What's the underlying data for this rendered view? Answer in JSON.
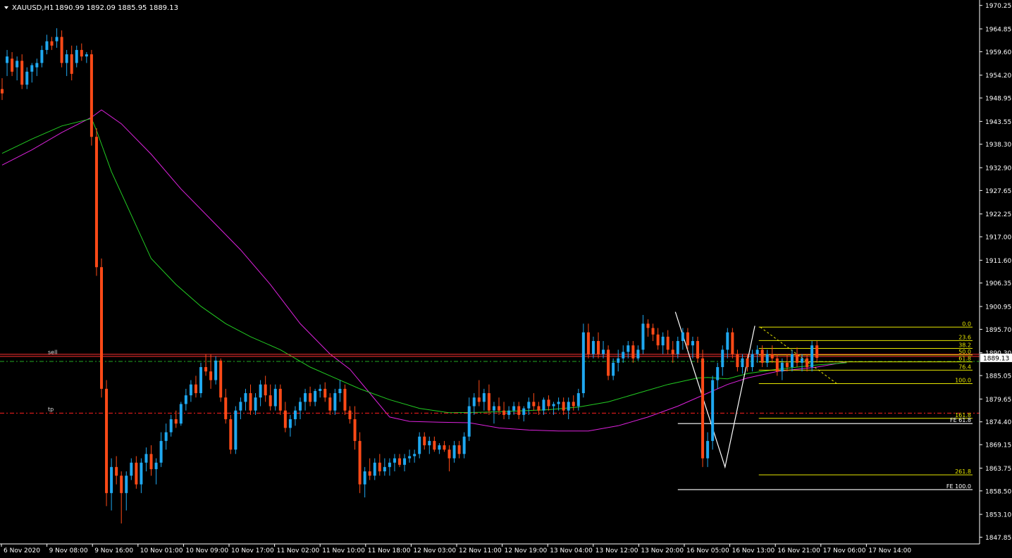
{
  "header": {
    "symbol": "XAUUSD,H1",
    "ohlc": "1890.99 1892.09 1885.95 1889.13"
  },
  "chart_data": {
    "type": "candlestick",
    "symbol": "XAUUSD",
    "timeframe": "H1",
    "ylim": [
      1846.3,
      1971.5
    ],
    "y_ticks": [
      "1970.25",
      "1964.85",
      "1959.60",
      "1954.20",
      "1948.95",
      "1943.55",
      "1938.30",
      "1932.90",
      "1927.65",
      "1922.25",
      "1917.00",
      "1911.60",
      "1906.35",
      "1900.95",
      "1895.70",
      "1890.30",
      "1885.05",
      "1879.65",
      "1874.40",
      "1869.15",
      "1863.75",
      "1858.50",
      "1853.10",
      "1847.85"
    ],
    "x_ticks": [
      "6 Nov 2020",
      "9 Nov 08:00",
      "9 Nov 16:00",
      "10 Nov 01:00",
      "10 Nov 09:00",
      "10 Nov 17:00",
      "11 Nov 02:00",
      "11 Nov 10:00",
      "11 Nov 18:00",
      "12 Nov 03:00",
      "12 Nov 11:00",
      "12 Nov 19:00",
      "13 Nov 04:00",
      "13 Nov 12:00",
      "13 Nov 20:00",
      "16 Nov 05:00",
      "16 Nov 13:00",
      "16 Nov 21:00",
      "17 Nov 06:00",
      "17 Nov 14:00"
    ],
    "colors": {
      "bull": "#1fa8f0",
      "bear": "#ff4a17",
      "ma_fast": "#22cc22",
      "ma_slow": "#dd22dd",
      "fib": "#e6e600",
      "fe": "#ffffff",
      "sell": "#ff3030",
      "tp": "#ff2020",
      "bid": "#22aa22"
    },
    "levels": {
      "sell": {
        "label": "sell",
        "price": 1889.7
      },
      "tp": {
        "label": "tp",
        "price": 1876.4
      },
      "bid": 1888.3,
      "current": {
        "label": "1889.13",
        "price": 1889.13
      }
    },
    "fib_retracement": [
      {
        "label": "0.0",
        "price": 1896.2
      },
      {
        "label": "23.6",
        "price": 1893.1
      },
      {
        "label": "38.2",
        "price": 1891.3
      },
      {
        "label": "50.0",
        "price": 1889.8
      },
      {
        "label": "61.8",
        "price": 1888.2
      },
      {
        "label": "76.4",
        "price": 1886.3
      },
      {
        "label": "100.0",
        "price": 1883.2
      },
      {
        "label": "161.8",
        "price": 1875.2
      },
      {
        "label": "261.8",
        "price": 1862.2
      }
    ],
    "fib_expansion": [
      {
        "label": "FE 61.8",
        "price": 1874.0
      },
      {
        "label": "FE 100.0",
        "price": 1858.8
      }
    ],
    "candles": [
      [
        1951.0,
        1953.5,
        1948.5,
        1950.0
      ],
      [
        1957.0,
        1960.0,
        1954.0,
        1958.5
      ],
      [
        1958.0,
        1959.5,
        1954.0,
        1955.0
      ],
      [
        1956.0,
        1958.5,
        1953.0,
        1957.5
      ],
      [
        1957.5,
        1959.0,
        1951.0,
        1952.0
      ],
      [
        1952.0,
        1956.0,
        1951.0,
        1955.0
      ],
      [
        1955.0,
        1957.0,
        1952.5,
        1956.5
      ],
      [
        1956.0,
        1958.0,
        1954.0,
        1957.0
      ],
      [
        1957.0,
        1961.0,
        1956.0,
        1960.0
      ],
      [
        1960.0,
        1963.5,
        1959.0,
        1962.0
      ],
      [
        1962.0,
        1963.0,
        1960.0,
        1961.0
      ],
      [
        1962.0,
        1965.0,
        1960.5,
        1963.0
      ],
      [
        1963.0,
        1964.5,
        1956.0,
        1957.0
      ],
      [
        1957.0,
        1960.0,
        1954.0,
        1959.0
      ],
      [
        1959.0,
        1961.0,
        1953.0,
        1954.5
      ],
      [
        1957.0,
        1961.0,
        1956.0,
        1960.0
      ],
      [
        1960.0,
        1961.5,
        1957.5,
        1958.5
      ],
      [
        1958.5,
        1959.5,
        1957.0,
        1959.0
      ],
      [
        1959.0,
        1960.0,
        1938.0,
        1940.0
      ],
      [
        1940.0,
        1942.0,
        1908.0,
        1910.0
      ],
      [
        1910.0,
        1912.0,
        1880.0,
        1882.0
      ],
      [
        1882.0,
        1884.0,
        1855.0,
        1858.0
      ],
      [
        1858.0,
        1866.0,
        1854.0,
        1864.0
      ],
      [
        1864.0,
        1866.5,
        1860.0,
        1862.0
      ],
      [
        1862.0,
        1863.0,
        1851.0,
        1858.0
      ],
      [
        1858.0,
        1863.0,
        1854.0,
        1862.0
      ],
      [
        1862.0,
        1866.0,
        1861.0,
        1865.0
      ],
      [
        1865.0,
        1866.5,
        1859.0,
        1860.0
      ],
      [
        1860.0,
        1866.0,
        1858.0,
        1865.0
      ],
      [
        1865.0,
        1868.5,
        1863.0,
        1867.0
      ],
      [
        1867.0,
        1869.0,
        1862.0,
        1863.5
      ],
      [
        1863.5,
        1866.0,
        1860.0,
        1865.0
      ],
      [
        1865.0,
        1872.0,
        1864.0,
        1870.0
      ],
      [
        1870.0,
        1874.0,
        1868.0,
        1872.0
      ],
      [
        1872.0,
        1876.0,
        1871.0,
        1875.0
      ],
      [
        1875.0,
        1877.0,
        1873.0,
        1874.0
      ],
      [
        1874.0,
        1879.0,
        1873.5,
        1878.5
      ],
      [
        1878.5,
        1882.0,
        1877.0,
        1880.5
      ],
      [
        1880.5,
        1884.0,
        1879.0,
        1883.0
      ],
      [
        1883.0,
        1885.0,
        1880.0,
        1881.0
      ],
      [
        1881.0,
        1888.0,
        1880.0,
        1887.0
      ],
      [
        1887.0,
        1890.0,
        1885.0,
        1886.0
      ],
      [
        1886.0,
        1890.0,
        1882.0,
        1884.0
      ],
      [
        1884.0,
        1889.5,
        1883.0,
        1888.5
      ],
      [
        1888.5,
        1889.0,
        1879.0,
        1880.0
      ],
      [
        1880.0,
        1882.0,
        1874.0,
        1875.0
      ],
      [
        1875.0,
        1876.0,
        1867.0,
        1868.0
      ],
      [
        1868.0,
        1878.0,
        1867.0,
        1877.0
      ],
      [
        1877.0,
        1880.0,
        1875.0,
        1879.0
      ],
      [
        1879.0,
        1882.0,
        1877.0,
        1881.0
      ],
      [
        1881.0,
        1883.0,
        1876.0,
        1877.0
      ],
      [
        1877.0,
        1881.0,
        1876.0,
        1880.0
      ],
      [
        1880.0,
        1884.0,
        1878.0,
        1883.0
      ],
      [
        1883.0,
        1885.0,
        1879.0,
        1880.5
      ],
      [
        1880.5,
        1883.0,
        1877.0,
        1878.0
      ],
      [
        1878.0,
        1883.0,
        1877.0,
        1882.0
      ],
      [
        1882.0,
        1883.0,
        1876.0,
        1877.0
      ],
      [
        1877.0,
        1879.0,
        1872.0,
        1873.0
      ],
      [
        1873.0,
        1876.0,
        1871.0,
        1875.0
      ],
      [
        1875.0,
        1878.0,
        1873.5,
        1877.0
      ],
      [
        1877.0,
        1880.0,
        1875.0,
        1879.0
      ],
      [
        1879.0,
        1882.0,
        1877.0,
        1881.0
      ],
      [
        1881.0,
        1882.5,
        1878.0,
        1879.0
      ],
      [
        1879.0,
        1882.0,
        1878.0,
        1881.5
      ],
      [
        1881.5,
        1883.0,
        1880.0,
        1882.0
      ],
      [
        1882.0,
        1883.5,
        1879.0,
        1880.0
      ],
      [
        1880.0,
        1881.0,
        1876.0,
        1877.0
      ],
      [
        1877.0,
        1882.0,
        1876.0,
        1881.0
      ],
      [
        1881.0,
        1884.0,
        1879.0,
        1882.0
      ],
      [
        1882.0,
        1883.0,
        1876.0,
        1877.0
      ],
      [
        1877.0,
        1878.0,
        1874.0,
        1875.0
      ],
      [
        1875.0,
        1878.0,
        1868.0,
        1870.0
      ],
      [
        1870.0,
        1872.0,
        1858.0,
        1860.0
      ],
      [
        1860.0,
        1864.0,
        1857.0,
        1863.0
      ],
      [
        1863.0,
        1866.0,
        1861.0,
        1862.0
      ],
      [
        1862.0,
        1866.0,
        1861.0,
        1865.0
      ],
      [
        1865.0,
        1867.0,
        1862.0,
        1863.0
      ],
      [
        1863.0,
        1866.0,
        1862.0,
        1864.0
      ],
      [
        1864.0,
        1866.0,
        1862.0,
        1865.0
      ],
      [
        1865.0,
        1867.0,
        1863.0,
        1866.0
      ],
      [
        1866.0,
        1867.0,
        1864.0,
        1864.5
      ],
      [
        1864.5,
        1867.0,
        1863.0,
        1866.0
      ],
      [
        1866.0,
        1868.0,
        1865.0,
        1866.5
      ],
      [
        1866.5,
        1868.0,
        1865.0,
        1867.0
      ],
      [
        1867.0,
        1872.0,
        1866.0,
        1871.0
      ],
      [
        1871.0,
        1872.0,
        1868.0,
        1869.0
      ],
      [
        1869.0,
        1871.0,
        1867.0,
        1870.0
      ],
      [
        1870.0,
        1871.0,
        1867.5,
        1868.0
      ],
      [
        1868.0,
        1869.5,
        1867.0,
        1869.0
      ],
      [
        1869.0,
        1870.0,
        1867.5,
        1868.0
      ],
      [
        1868.0,
        1869.0,
        1863.0,
        1866.0
      ],
      [
        1866.0,
        1870.0,
        1865.0,
        1869.0
      ],
      [
        1869.0,
        1870.0,
        1866.0,
        1867.0
      ],
      [
        1867.0,
        1872.0,
        1866.0,
        1871.0
      ],
      [
        1871.0,
        1880.0,
        1870.0,
        1878.0
      ],
      [
        1878.0,
        1881.0,
        1876.0,
        1880.0
      ],
      [
        1880.0,
        1884.0,
        1878.0,
        1879.0
      ],
      [
        1879.0,
        1882.0,
        1877.0,
        1881.0
      ],
      [
        1881.0,
        1883.0,
        1876.0,
        1877.0
      ],
      [
        1877.0,
        1879.0,
        1874.0,
        1878.0
      ],
      [
        1878.0,
        1880.0,
        1876.0,
        1877.0
      ],
      [
        1877.0,
        1879.0,
        1875.0,
        1876.0
      ],
      [
        1876.0,
        1878.0,
        1875.0,
        1877.0
      ],
      [
        1877.0,
        1879.0,
        1876.0,
        1878.0
      ],
      [
        1878.0,
        1879.0,
        1875.0,
        1876.0
      ],
      [
        1876.0,
        1878.0,
        1874.5,
        1877.5
      ],
      [
        1877.5,
        1880.0,
        1876.0,
        1879.0
      ],
      [
        1879.0,
        1881.0,
        1877.0,
        1878.0
      ],
      [
        1878.0,
        1879.0,
        1876.0,
        1877.0
      ],
      [
        1877.0,
        1880.0,
        1876.0,
        1879.5
      ],
      [
        1879.5,
        1880.5,
        1877.0,
        1878.0
      ],
      [
        1878.0,
        1879.0,
        1876.0,
        1878.5
      ],
      [
        1878.5,
        1880.0,
        1877.0,
        1879.0
      ],
      [
        1879.0,
        1880.0,
        1876.0,
        1877.0
      ],
      [
        1877.0,
        1880.0,
        1875.0,
        1879.0
      ],
      [
        1879.0,
        1880.5,
        1877.0,
        1878.0
      ],
      [
        1878.0,
        1882.0,
        1877.0,
        1881.0
      ],
      [
        1881.0,
        1897.0,
        1880.0,
        1895.0
      ],
      [
        1895.0,
        1897.0,
        1889.0,
        1890.0
      ],
      [
        1890.0,
        1894.0,
        1889.0,
        1893.0
      ],
      [
        1893.0,
        1895.0,
        1889.0,
        1890.0
      ],
      [
        1890.0,
        1893.0,
        1889.0,
        1891.0
      ],
      [
        1891.0,
        1892.0,
        1884.0,
        1885.0
      ],
      [
        1885.0,
        1889.0,
        1884.0,
        1888.0
      ],
      [
        1888.0,
        1891.0,
        1886.0,
        1889.0
      ],
      [
        1889.0,
        1892.0,
        1888.0,
        1890.5
      ],
      [
        1890.5,
        1893.0,
        1889.0,
        1892.0
      ],
      [
        1892.0,
        1893.0,
        1888.0,
        1889.0
      ],
      [
        1889.0,
        1892.0,
        1888.5,
        1891.0
      ],
      [
        1891.0,
        1899.0,
        1890.0,
        1897.0
      ],
      [
        1897.0,
        1898.0,
        1894.0,
        1896.0
      ],
      [
        1896.0,
        1897.0,
        1893.0,
        1894.5
      ],
      [
        1894.5,
        1896.0,
        1891.0,
        1892.0
      ],
      [
        1892.0,
        1895.0,
        1890.0,
        1894.0
      ],
      [
        1894.0,
        1895.5,
        1890.0,
        1891.0
      ],
      [
        1891.0,
        1893.0,
        1888.0,
        1890.0
      ],
      [
        1890.0,
        1894.0,
        1889.0,
        1893.0
      ],
      [
        1893.0,
        1896.0,
        1891.0,
        1895.0
      ],
      [
        1895.0,
        1896.0,
        1891.0,
        1892.0
      ],
      [
        1892.0,
        1894.0,
        1889.0,
        1893.0
      ],
      [
        1893.0,
        1894.0,
        1888.0,
        1889.0
      ],
      [
        1889.0,
        1891.0,
        1864.0,
        1866.0
      ],
      [
        1866.0,
        1872.0,
        1864.0,
        1870.0
      ],
      [
        1870.0,
        1885.0,
        1868.0,
        1884.0
      ],
      [
        1884.0,
        1888.0,
        1882.0,
        1887.0
      ],
      [
        1887.0,
        1892.0,
        1885.0,
        1891.0
      ],
      [
        1891.0,
        1896.0,
        1889.0,
        1895.0
      ],
      [
        1895.0,
        1896.0,
        1889.0,
        1890.0
      ],
      [
        1890.0,
        1891.0,
        1886.0,
        1887.0
      ],
      [
        1887.0,
        1890.0,
        1885.5,
        1889.0
      ],
      [
        1889.0,
        1890.0,
        1886.0,
        1887.0
      ],
      [
        1887.0,
        1891.0,
        1886.0,
        1890.0
      ],
      [
        1890.0,
        1892.0,
        1888.0,
        1891.0
      ],
      [
        1891.0,
        1892.0,
        1887.0,
        1888.0
      ],
      [
        1888.0,
        1891.0,
        1887.0,
        1890.0
      ],
      [
        1890.0,
        1892.0,
        1888.0,
        1889.0
      ],
      [
        1889.0,
        1890.0,
        1885.0,
        1886.0
      ],
      [
        1886.0,
        1889.0,
        1884.0,
        1888.0
      ],
      [
        1888.0,
        1890.0,
        1886.0,
        1887.0
      ],
      [
        1887.0,
        1891.0,
        1886.0,
        1890.0
      ],
      [
        1890.0,
        1891.5,
        1887.0,
        1888.0
      ],
      [
        1888.0,
        1890.0,
        1886.0,
        1889.0
      ],
      [
        1889.0,
        1890.0,
        1886.0,
        1887.0
      ],
      [
        1887.0,
        1893.0,
        1886.0,
        1892.0
      ],
      [
        1892.0,
        1893.0,
        1888.0,
        1889.13
      ]
    ],
    "ma_fast": [
      [
        0,
        1936.2
      ],
      [
        6,
        1939.5
      ],
      [
        12,
        1942.5
      ],
      [
        18,
        1944.2
      ],
      [
        19,
        1941.5
      ],
      [
        22,
        1932.0
      ],
      [
        26,
        1922.0
      ],
      [
        30,
        1912.0
      ],
      [
        35,
        1906.0
      ],
      [
        40,
        1901.0
      ],
      [
        45,
        1897.0
      ],
      [
        50,
        1894.0
      ],
      [
        56,
        1891.0
      ],
      [
        62,
        1887.0
      ],
      [
        66,
        1885.0
      ],
      [
        72,
        1882.0
      ],
      [
        78,
        1879.5
      ],
      [
        84,
        1877.5
      ],
      [
        90,
        1876.5
      ],
      [
        96,
        1876.6
      ],
      [
        102,
        1876.8
      ],
      [
        110,
        1877.2
      ],
      [
        116,
        1877.8
      ],
      [
        122,
        1879.0
      ],
      [
        128,
        1881.0
      ],
      [
        134,
        1883.0
      ],
      [
        140,
        1884.5
      ],
      [
        142,
        1884.6
      ],
      [
        146,
        1884.3
      ],
      [
        150,
        1885.5
      ],
      [
        156,
        1886.5
      ],
      [
        164,
        1887.5
      ],
      [
        170,
        1888.0
      ]
    ],
    "ma_slow": [
      [
        0,
        1933.5
      ],
      [
        6,
        1937.0
      ],
      [
        12,
        1941.0
      ],
      [
        18,
        1944.5
      ],
      [
        20,
        1946.2
      ],
      [
        24,
        1943.0
      ],
      [
        30,
        1936.0
      ],
      [
        36,
        1928.0
      ],
      [
        42,
        1921.0
      ],
      [
        48,
        1914.0
      ],
      [
        54,
        1906.0
      ],
      [
        60,
        1897.0
      ],
      [
        66,
        1890.0
      ],
      [
        70,
        1886.5
      ],
      [
        74,
        1881.0
      ],
      [
        78,
        1875.5
      ],
      [
        82,
        1874.5
      ],
      [
        88,
        1874.3
      ],
      [
        94,
        1874.2
      ],
      [
        100,
        1873.0
      ],
      [
        106,
        1872.5
      ],
      [
        112,
        1872.3
      ],
      [
        118,
        1872.3
      ],
      [
        124,
        1873.5
      ],
      [
        130,
        1875.5
      ],
      [
        136,
        1878.0
      ],
      [
        142,
        1881.0
      ],
      [
        146,
        1883.0
      ],
      [
        150,
        1884.5
      ],
      [
        156,
        1886.0
      ],
      [
        164,
        1887.0
      ],
      [
        170,
        1888.2
      ]
    ]
  }
}
